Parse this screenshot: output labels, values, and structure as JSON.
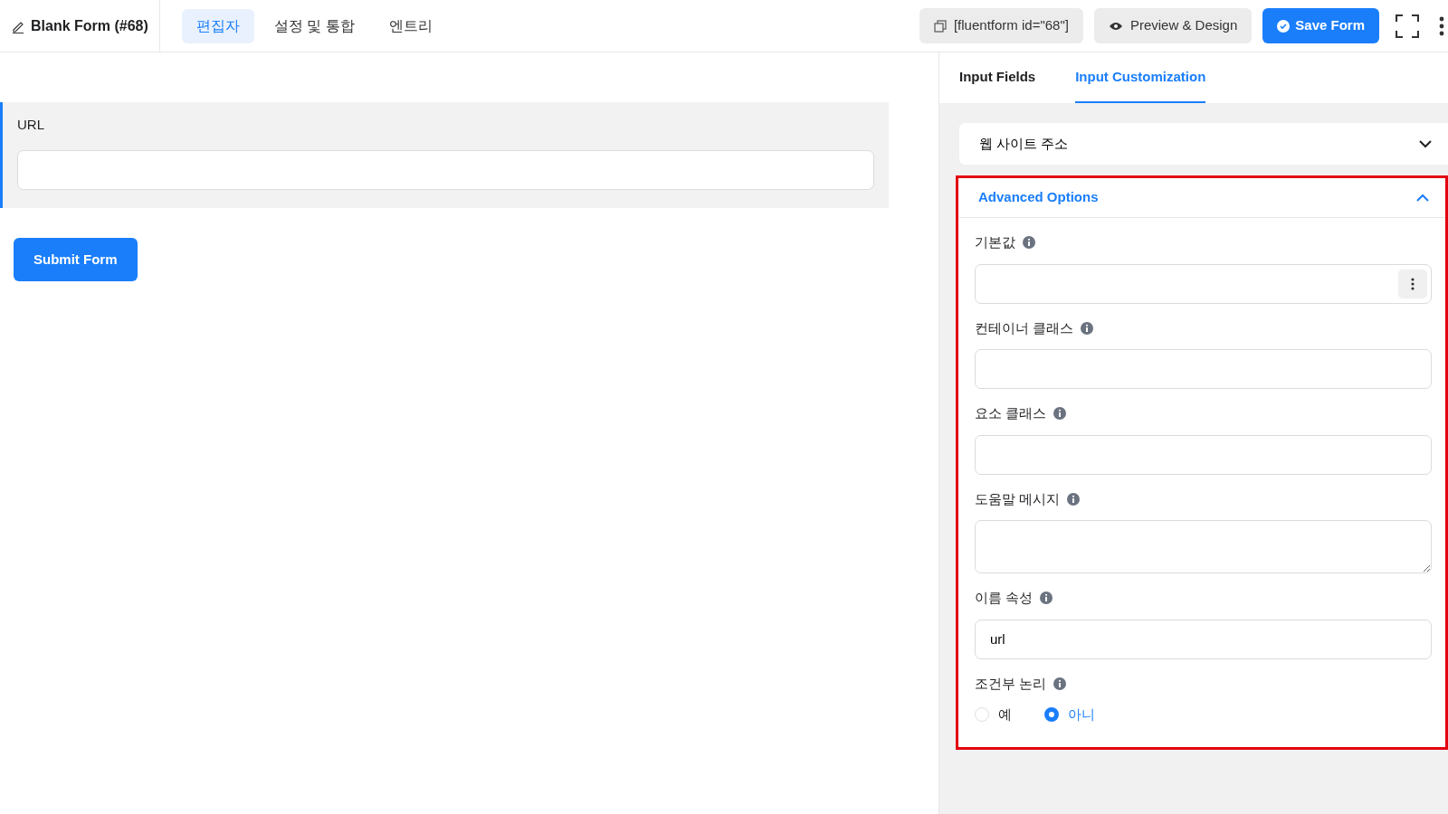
{
  "header": {
    "title": "Blank Form (#68)",
    "tabs": [
      {
        "label": "편집자",
        "selected": true
      },
      {
        "label": "설정 및 통합",
        "selected": false
      },
      {
        "label": "엔트리",
        "selected": false
      }
    ],
    "shortcode": "[fluentform id=\"68\"]",
    "preview": "Preview & Design",
    "save": "Save Form"
  },
  "form": {
    "fields": [
      {
        "label": "URL"
      }
    ],
    "submit": "Submit Form"
  },
  "panel": {
    "tabs": [
      {
        "label": "Input Fields",
        "selected": false
      },
      {
        "label": "Input Customization",
        "selected": true
      }
    ],
    "sections": [
      {
        "title": "웹 사이트 주소",
        "expanded": false
      },
      {
        "title": "Advanced Options",
        "expanded": true
      }
    ],
    "options": [
      {
        "kind": "menu-input",
        "label": "기본값"
      },
      {
        "kind": "input",
        "label": "컨테이너 클래스"
      },
      {
        "kind": "input",
        "label": "요소 클래스"
      },
      {
        "kind": "textarea",
        "label": "도움말 메시지"
      },
      {
        "kind": "input",
        "label": "이름 속성",
        "value": "url"
      },
      {
        "kind": "radio",
        "label": "조건부 논리",
        "choices": [
          {
            "label": "예",
            "selected": false
          },
          {
            "label": "아니",
            "selected": true
          }
        ]
      }
    ]
  }
}
